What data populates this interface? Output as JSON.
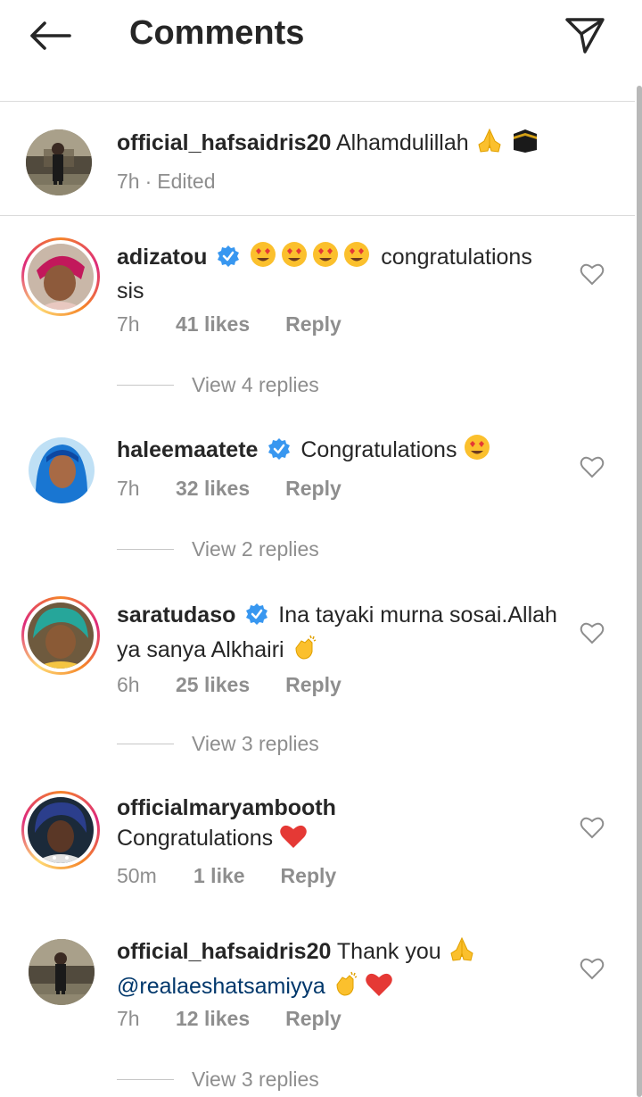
{
  "header": {
    "title": "Comments",
    "back_icon": "arrow-left-icon",
    "send_icon": "paper-plane-icon"
  },
  "post": {
    "username": "official_hafsaidris20",
    "caption": "Alhamdulillah",
    "time": "7h",
    "edited": "Edited",
    "separator": "·"
  },
  "comments": [
    {
      "username": "adizatou",
      "verified": true,
      "text": "congratulations sis",
      "time": "7h",
      "likes": "41 likes",
      "reply": "Reply",
      "view_replies": "View 4 replies"
    },
    {
      "username": "haleemaatete",
      "verified": true,
      "text": "Congratulations",
      "time": "7h",
      "likes": "32 likes",
      "reply": "Reply",
      "view_replies": "View 2 replies"
    },
    {
      "username": "saratudaso",
      "verified": true,
      "text": "Ina tayaki murna sosai.Allah ya sanya Alkhairi",
      "time": "6h",
      "likes": "25 likes",
      "reply": "Reply",
      "view_replies": "View 3 replies"
    },
    {
      "username": "officialmaryambooth",
      "verified": false,
      "text": "Congratulations",
      "time": "50m",
      "likes": "1 like",
      "reply": "Reply"
    },
    {
      "username": "official_hafsaidris20",
      "verified": false,
      "text": "Thank you",
      "mention": "@realaeshatsamiyya",
      "time": "7h",
      "likes": "12 likes",
      "reply": "Reply",
      "view_replies": "View 3 replies"
    }
  ],
  "colors": {
    "primary_text": "#262626",
    "secondary_text": "#8e8e8e",
    "verified_blue": "#3897f0",
    "mention": "#00376b",
    "divider": "#dbdbdb"
  }
}
